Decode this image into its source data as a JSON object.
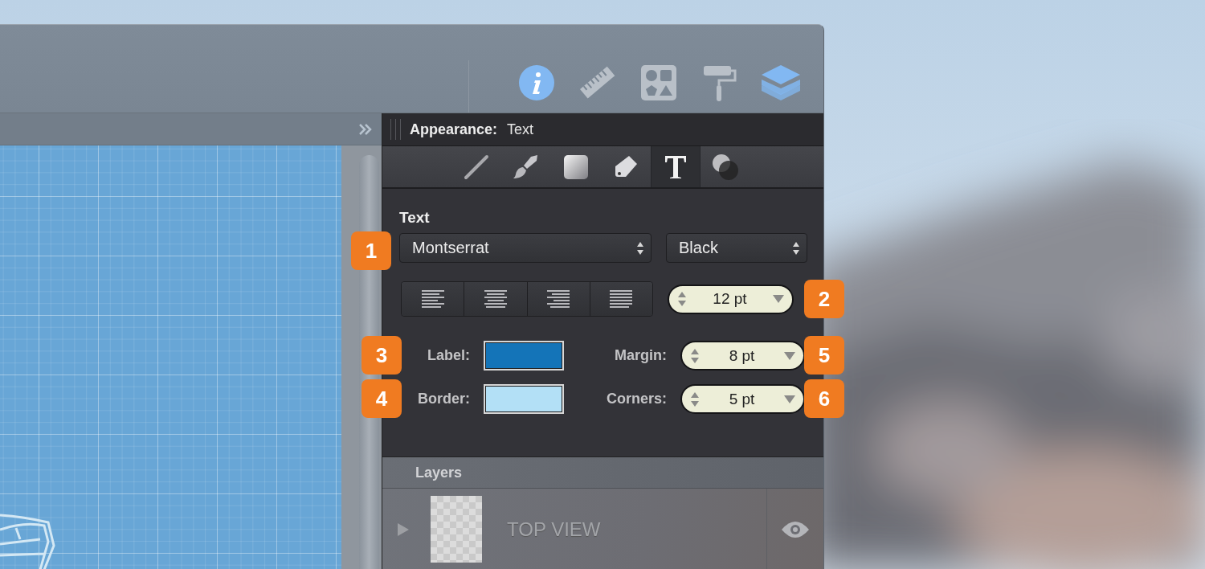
{
  "toolbar": {
    "icons": [
      {
        "kind": "info",
        "active": true
      },
      {
        "kind": "ruler",
        "active": false
      },
      {
        "kind": "shapes",
        "active": false
      },
      {
        "kind": "roller",
        "active": false
      },
      {
        "kind": "layers",
        "active": true
      }
    ]
  },
  "inspector": {
    "title": "Appearance:",
    "subject": "Text",
    "tabs": [
      {
        "kind": "line",
        "selected": false
      },
      {
        "kind": "brush",
        "selected": false
      },
      {
        "kind": "fill",
        "selected": false
      },
      {
        "kind": "tag",
        "selected": false
      },
      {
        "kind": "text",
        "selected": true
      },
      {
        "kind": "shadow",
        "selected": false
      }
    ],
    "section": "Text",
    "font_family": "Montserrat",
    "font_style": "Black",
    "alignments": [
      {
        "kind": "left"
      },
      {
        "kind": "center"
      },
      {
        "kind": "right"
      },
      {
        "kind": "justify"
      }
    ],
    "font_size": "12 pt",
    "rows": [
      {
        "label": "Label:",
        "color": "#1474b8",
        "field_label": "Margin:",
        "field_value": "8 pt"
      },
      {
        "label": "Border:",
        "color": "#b3e0f6",
        "field_label": "Corners:",
        "field_value": "5 pt"
      }
    ]
  },
  "layers": {
    "title": "Layers",
    "rows": [
      {
        "name": "TOP VIEW",
        "expanded": false,
        "visible": true
      }
    ]
  },
  "badges": [
    "1",
    "2",
    "3",
    "5",
    "4",
    "6"
  ]
}
